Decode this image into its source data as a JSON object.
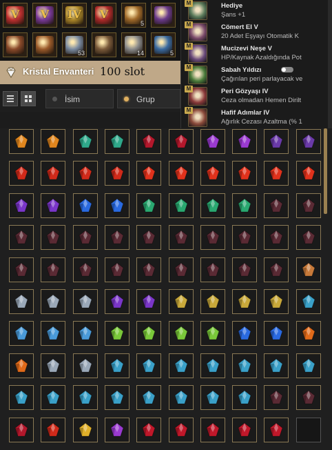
{
  "top_icons": {
    "row1": [
      {
        "name": "scroll-v-icon",
        "letter": "V",
        "color": "#c03030",
        "count": ""
      },
      {
        "name": "emblem-v-icon",
        "letter": "V",
        "color": "#7a3a9a",
        "count": ""
      },
      {
        "name": "tome-iv-icon",
        "letter": "IV",
        "color": "#b08a2a",
        "count": ""
      },
      {
        "name": "banner-v-icon",
        "letter": "V",
        "color": "#b02a2a",
        "count": ""
      },
      {
        "name": "map-scroll-icon",
        "letter": "",
        "color": "#a06a2a",
        "count": "5"
      },
      {
        "name": "rune-frame-icon",
        "letter": "",
        "color": "#6a3a8a",
        "count": ""
      }
    ],
    "row2": [
      {
        "name": "key-bundle-icon",
        "letter": "",
        "color": "#8a4a2a",
        "count": ""
      },
      {
        "name": "lantern-icon",
        "letter": "",
        "color": "#9a5a2a",
        "count": ""
      },
      {
        "name": "crystal-shard-icon",
        "letter": "",
        "color": "#7a8aa0",
        "count": "53"
      },
      {
        "name": "treasure-chest-icon",
        "letter": "",
        "color": "#7a5a3a",
        "count": ""
      },
      {
        "name": "blueprint-icon",
        "letter": "",
        "color": "#8a8a8a",
        "count": "14"
      },
      {
        "name": "snowflake-icon",
        "letter": "",
        "color": "#3a6aa0",
        "count": "5"
      }
    ]
  },
  "header": {
    "title": "Kristal Envanteri",
    "slots": "100 slot"
  },
  "filters": {
    "name_label": "İsim",
    "group_label": "Grup"
  },
  "buffs": [
    {
      "tag": "M",
      "name": "Hediye",
      "desc": "Şans +1",
      "color": "#5a7a5a"
    },
    {
      "tag": "M",
      "name": "Cömert El V",
      "desc": "20 Adet Eşyayı Otomatik K",
      "color": "#7a4a6a"
    },
    {
      "tag": "M",
      "name": "Mucizevi Neşe V",
      "desc": "HP/Kaynak Azaldığında Pot",
      "color": "#6a4a7a"
    },
    {
      "tag": "M",
      "name": "Sabah Yıldızı",
      "desc": "Çağırılan peri parlayacak ve",
      "color": "#4a7a3a",
      "toggle": true
    },
    {
      "tag": "M",
      "name": "Peri Gözyaşı IV",
      "desc": "Ceza olmadan Hemen Dirilt",
      "color": "#8a3a3a"
    },
    {
      "tag": "M",
      "name": "Hafif Adımlar IV",
      "desc": "Ağırlık Cezası Azaltma (% 1",
      "color": "#8a4a3a"
    }
  ],
  "inventory": {
    "rows": [
      [
        "amber",
        "amber",
        "emerald",
        "emerald",
        "ruby",
        "ruby",
        "amethyst",
        "amethyst",
        "violet",
        "violet"
      ],
      [
        "garnet",
        "garnet",
        "garnet",
        "garnet",
        "fire",
        "fire",
        "fire",
        "fire",
        "fire",
        "fire"
      ],
      [
        "purple",
        "purple",
        "sapphire",
        "sapphire",
        "jade",
        "jade",
        "jade",
        "jade",
        "dark",
        "dark"
      ],
      [
        "dark",
        "dark",
        "dark",
        "dark",
        "dark",
        "dark",
        "dark",
        "dark",
        "dark",
        "dark"
      ],
      [
        "dark",
        "dark",
        "dark",
        "dark",
        "dark",
        "dark",
        "dark",
        "dark",
        "dark",
        "smoky"
      ],
      [
        "silver",
        "silver",
        "silver",
        "purple",
        "purple",
        "citrine",
        "citrine",
        "citrine",
        "citrine",
        "aqua"
      ],
      [
        "prism",
        "prism",
        "prism",
        "lime",
        "lime",
        "lime",
        "lime",
        "sapphire",
        "sapphire",
        "orange"
      ],
      [
        "orange",
        "silver",
        "silver",
        "aqua",
        "aqua",
        "aqua",
        "aqua",
        "aqua",
        "aqua",
        "aqua"
      ],
      [
        "aqua",
        "aqua",
        "aqua",
        "aqua",
        "aqua",
        "aqua",
        "aqua",
        "aqua",
        "dark",
        "dark"
      ],
      [
        "ruby",
        "garnet",
        "gold",
        "amethyst",
        "star",
        "star",
        "star",
        "star",
        "star",
        "empty"
      ]
    ]
  },
  "gem_colors": {
    "amber": "#e0861e",
    "emerald": "#2fa88a",
    "ruby": "#b3182c",
    "amethyst": "#9a3ad0",
    "violet": "#6a3aa8",
    "garnet": "#d02a1a",
    "fire": "#e0321c",
    "purple": "#7a36c8",
    "sapphire": "#2a6ae0",
    "jade": "#2aa870",
    "dark": "#5a2a34",
    "smoky": "#c87a3a",
    "silver": "#9aa8b8",
    "citrine": "#c8a83a",
    "aqua": "#3aa0c8",
    "prism": "#4a9ad8",
    "lime": "#7ac83a",
    "orange": "#e06a1a",
    "gold": "#e0b02a",
    "star": "#c0182a"
  }
}
